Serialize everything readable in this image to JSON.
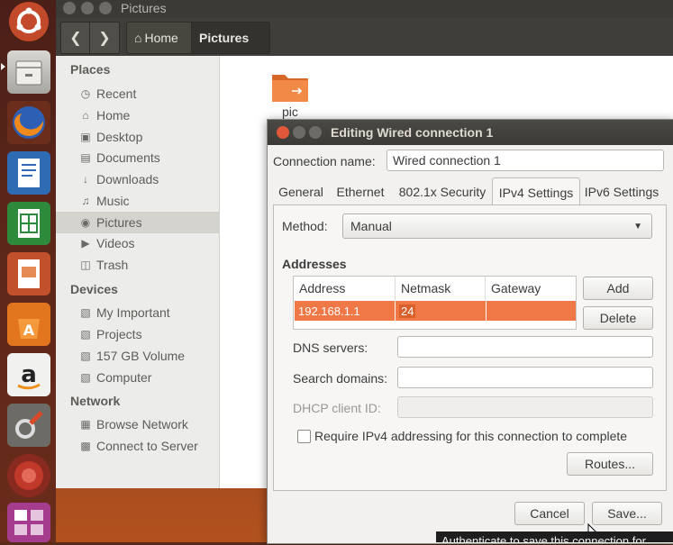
{
  "launcher": {
    "items": [
      "ubuntu-dash",
      "files",
      "firefox",
      "writer",
      "calc",
      "impress",
      "software-center",
      "amazon",
      "system-settings",
      "unknown-app",
      "workspace-switcher"
    ]
  },
  "nautilus": {
    "window_title": "Pictures",
    "toolbar": {
      "home_label": "Home",
      "current_label": "Pictures"
    },
    "sidebar": {
      "places_header": "Places",
      "places": [
        "Recent",
        "Home",
        "Desktop",
        "Documents",
        "Downloads",
        "Music",
        "Pictures",
        "Videos",
        "Trash"
      ],
      "devices_header": "Devices",
      "devices": [
        "My Important",
        "Projects",
        "157 GB Volume",
        "Computer"
      ],
      "network_header": "Network",
      "network": [
        "Browse Network",
        "Connect to Server"
      ]
    },
    "files": [
      {
        "name": "pic"
      }
    ]
  },
  "dialog": {
    "title": "Editing Wired connection 1",
    "connection_name_label": "Connection name:",
    "connection_name_value": "Wired connection 1",
    "tabs": [
      "General",
      "Ethernet",
      "802.1x Security",
      "IPv4 Settings",
      "IPv6 Settings"
    ],
    "active_tab": "IPv4 Settings",
    "method_label": "Method:",
    "method_value": "Manual",
    "addresses_header": "Addresses",
    "table": {
      "columns": [
        "Address",
        "Netmask",
        "Gateway"
      ],
      "rows": [
        {
          "address": "192.168.1.1",
          "netmask": "24",
          "gateway": ""
        }
      ]
    },
    "add_label": "Add",
    "delete_label": "Delete",
    "dns_label": "DNS servers:",
    "dns_value": "",
    "search_label": "Search domains:",
    "search_value": "",
    "dhcp_label": "DHCP client ID:",
    "dhcp_value": "",
    "require_ipv4_label": "Require IPv4 addressing for this connection to complete",
    "require_ipv4_checked": false,
    "routes_label": "Routes...",
    "cancel_label": "Cancel",
    "save_label": "Save..."
  },
  "tooltip": "Authenticate to save this connection for",
  "colors": {
    "accent": "#f07746",
    "titlebar": "#3b3a36",
    "launcher": "#5b2619"
  }
}
